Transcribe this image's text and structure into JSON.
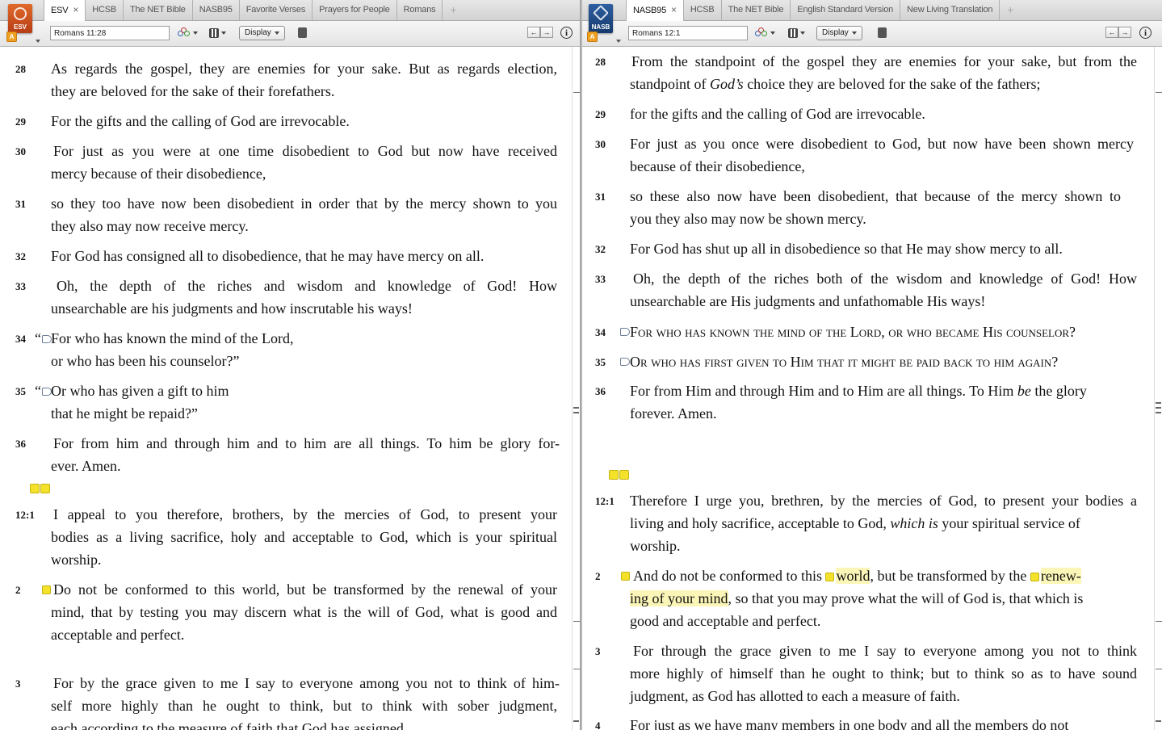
{
  "left": {
    "icon": {
      "abbr": "ESV",
      "badge": "A"
    },
    "tabs": [
      {
        "label": "ESV",
        "active": true,
        "close": "×"
      },
      {
        "label": "HCSB"
      },
      {
        "label": "The NET Bible"
      },
      {
        "label": "NASB95"
      },
      {
        "label": "Favorite Verses"
      },
      {
        "label": "Prayers for People"
      },
      {
        "label": "Romans"
      }
    ],
    "add_tab": "+",
    "reference": "Romans 11:28",
    "display_label": "Display",
    "nav": {
      "back": "←",
      "forward": "→"
    },
    "info": "i",
    "verses": {
      "v28": {
        "num": "28",
        "lines": [
          "As regards the gospel, they are enemies for your sake. But as regards election,",
          "they are beloved for the sake of their forefathers."
        ]
      },
      "v29": {
        "num": "29",
        "lines": [
          "For the gifts and the calling of God are irrevocable."
        ]
      },
      "v30": {
        "num": "30",
        "lines": [
          "For just as you were at one time disobedient to God but now have received",
          "mercy because of their disobedience,"
        ]
      },
      "v31": {
        "num": "31",
        "lines": [
          "so they too have now been disobedient in order that by the mercy shown to you",
          "they also may now receive mercy."
        ]
      },
      "v32": {
        "num": "32",
        "lines": [
          "For God has consigned all to disobedience, that he may have mercy on all."
        ]
      },
      "v33": {
        "num": "33",
        "lines": [
          "Oh, the depth of the riches and wisdom and knowledge of God! How",
          "unsearchable are his judgments and how inscrutable his ways!"
        ]
      },
      "v34": {
        "num": "34",
        "quote": "“",
        "lines": [
          "For who has known the mind of the Lord,",
          "or who has been his counselor?”"
        ]
      },
      "v35": {
        "num": "35",
        "quote": "“",
        "lines": [
          "Or who has given a gift to him",
          "that he might be repaid?”"
        ]
      },
      "v36": {
        "num": "36",
        "lines": [
          "For from him and through him and to him are all things. To him be glory for-",
          "ever. Amen."
        ]
      },
      "v12_1": {
        "num": "12:1",
        "lines": [
          "I appeal to you therefore, brothers, by the mercies of God, to present your",
          "bodies as a living sacrifice, holy and acceptable to God, which is your spiritual",
          "worship."
        ]
      },
      "v2": {
        "num": "2",
        "lines": [
          "Do not be conformed to this world, but be transformed by the renewal of your",
          "mind, that by testing you may discern what is the will of God, what is good and",
          "acceptable and perfect."
        ]
      },
      "v3": {
        "num": "3",
        "lines": [
          "For by the grace given to me I say to everyone among you not to think of him-",
          "self more highly than he ought to think, but to think with sober judgment,",
          "each according to the measure of faith that God has assigned."
        ]
      }
    }
  },
  "right": {
    "icon": {
      "abbr": "NASB",
      "badge": "A"
    },
    "tabs": [
      {
        "label": "NASB95",
        "active": true,
        "close": "×"
      },
      {
        "label": "HCSB"
      },
      {
        "label": "The NET Bible"
      },
      {
        "label": "English Standard Version"
      },
      {
        "label": "New Living Translation"
      }
    ],
    "add_tab": "+",
    "reference": "Romans 12:1",
    "display_label": "Display",
    "nav": {
      "back": "←",
      "forward": "→"
    },
    "info": "i",
    "verses": {
      "v28": {
        "num": "28",
        "lines": [
          "From the standpoint of the gospel they are enemies for your sake, but from the"
        ],
        "l2a": "standpoint of ",
        "l2b": "God’s",
        "l2c": " choice they are beloved for the sake of the fathers;"
      },
      "v29": {
        "num": "29",
        "lines": [
          "for the gifts and the calling of God are irrevocable."
        ]
      },
      "v30": {
        "num": "30",
        "lines": [
          "For just as you once were disobedient to God, but now have been shown mercy",
          "because of their disobedience,"
        ]
      },
      "v31": {
        "num": "31",
        "lines": [
          "so these also now have been disobedient, that because of the mercy shown to",
          "you they also may now be shown mercy."
        ]
      },
      "v32": {
        "num": "32",
        "lines": [
          "For God has shut up all in disobedience so that He may show mercy to all."
        ]
      },
      "v33": {
        "num": "33",
        "lines": [
          "Oh, the depth of the riches both of the wisdom and knowledge of God! How",
          "unsearchable are His judgments and unfathomable His ways!"
        ]
      },
      "v34": {
        "num": "34",
        "lines": [
          "For who has known the mind of the Lord, or who became His counselor?"
        ]
      },
      "v35": {
        "num": "35",
        "lines": [
          "Or who has first given to Him that it might be paid back to him again?"
        ]
      },
      "v36": {
        "num": "36",
        "l1a": "For from Him and through Him and to Him are all things. To Him ",
        "l1b": "be",
        "l1c": " the glory",
        "lines": [
          "forever. Amen."
        ]
      },
      "v12_1": {
        "num": "12:1",
        "lines": [
          "Therefore I urge you, brethren, by the mercies of God, to present your bodies a"
        ],
        "l2a": "living and holy sacrifice, acceptable to God, ",
        "l2b": "which is",
        "l2c": " your spiritual service of",
        "l3": "worship."
      },
      "v2": {
        "num": "2",
        "l1a": "And do not be conformed to this ",
        "l1b": "world",
        "l1c": ", but be transformed by the ",
        "l1d": "renew-",
        "l2a": "ing of your mind",
        "l2b": ", so that you may prove what the will of God is, that which is",
        "l3": "good and acceptable and perfect."
      },
      "v3": {
        "num": "3",
        "lines": [
          "For through the grace given to me I say to everyone among you not to think",
          "more highly of himself than he ought to think; but to think so as to have sound",
          "judgment, as God has allotted to each a measure of faith."
        ]
      },
      "v4": {
        "num": "4",
        "lines": [
          "For just as we have many members in one body and all the members do not"
        ]
      }
    }
  }
}
